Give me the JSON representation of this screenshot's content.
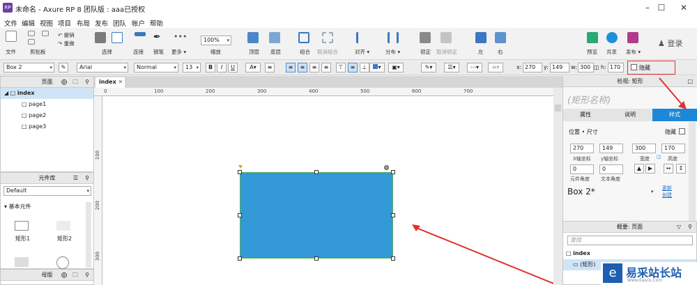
{
  "window": {
    "title": "未命名 - Axure RP 8 团队版 : aaa已授权",
    "app_icon_text": "RP"
  },
  "menu": [
    "文件",
    "编辑",
    "视图",
    "项目",
    "布局",
    "发布",
    "团队",
    "帐户",
    "帮助"
  ],
  "ribbon": {
    "file": "文件",
    "clipboard": "剪贴板",
    "undo": "撤销",
    "redo": "重做",
    "select": "选择",
    "connect": "连接",
    "pen": "钢笔",
    "more": "更多 ▾",
    "zoom_value": "100%",
    "zoom": "缩放",
    "top": "顶层",
    "bottom": "底层",
    "group": "组合",
    "ungroup": "取消组合",
    "align": "对齐 ▾",
    "distribute": "分布 ▾",
    "lock": "锁定",
    "unlock": "取消锁定",
    "left": "左",
    "right": "右",
    "preview": "预览",
    "share": "共享",
    "publish": "发布 ▾",
    "login": "登录"
  },
  "format": {
    "widget_name": "Box 2",
    "font": "Arial",
    "weight": "Normal",
    "size": "13",
    "x_label": "x:",
    "x": "270",
    "y_label": "y:",
    "y": "149",
    "w_label": "w:",
    "w": "300",
    "h_label": "h:",
    "h": "170",
    "hidden": "隐藏"
  },
  "pages_panel": {
    "title": "页面",
    "root": "index",
    "pages": [
      "page1",
      "page2",
      "page3"
    ]
  },
  "library_panel": {
    "title": "元件库",
    "selected_library": "Default",
    "section": "基本元件",
    "items": [
      "矩形1",
      "矩形2"
    ]
  },
  "masters_panel": {
    "title": "母版"
  },
  "canvas": {
    "tab": "index",
    "ruler_top": [
      "0",
      "100",
      "200",
      "300",
      "400",
      "500",
      "600",
      "700"
    ],
    "ruler_left": [
      "100",
      "200",
      "300"
    ],
    "box_color": "#3399d6"
  },
  "inspector": {
    "header": "检视: 矩形",
    "name_placeholder": "(矩形名称)",
    "tabs": [
      "属性",
      "说明",
      "样式"
    ],
    "section": "位置 • 尺寸",
    "hidden": "隐藏",
    "x": "270",
    "y": "149",
    "w": "300",
    "h": "170",
    "x_label": "X轴坐标",
    "y_label": "y轴坐标",
    "w_label": "宽度",
    "h_label": "高度",
    "rot1": "0",
    "rot2": "0",
    "rot1_label": "元件角度",
    "rot2_label": "文本角度",
    "style_name": "Box 2*",
    "update": "更新",
    "create": "创建"
  },
  "outline_panel": {
    "title": "概要: 页面",
    "search_placeholder": "查找",
    "root": "index",
    "child": "(矩形)"
  },
  "watermark": {
    "text": "易采站长站",
    "sub": "Www.Easck.Com"
  }
}
